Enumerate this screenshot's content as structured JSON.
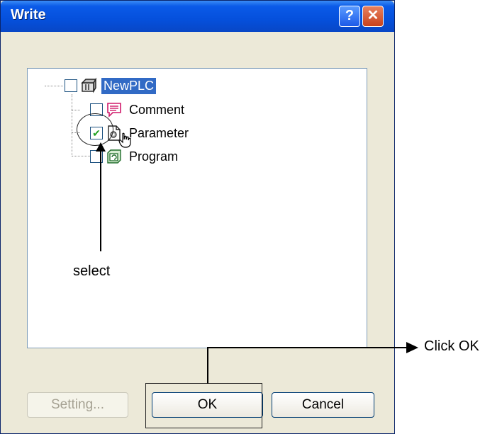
{
  "window": {
    "title": "Write",
    "help_glyph": "?",
    "close_glyph": "✕"
  },
  "tree": {
    "root": {
      "label": "NewPLC",
      "checked": false,
      "icon": "plc-icon"
    },
    "children": [
      {
        "label": "Comment",
        "checked": false,
        "icon": "comment-icon"
      },
      {
        "label": "Parameter",
        "checked": true,
        "icon": "parameter-icon"
      },
      {
        "label": "Program",
        "checked": false,
        "icon": "program-icon"
      }
    ]
  },
  "annotations": {
    "select_label": "select",
    "click_ok_label": "Click OK"
  },
  "buttons": {
    "setting": "Setting...",
    "ok": "OK",
    "cancel": "Cancel"
  },
  "colors": {
    "titlebar": "#0550dc",
    "selection": "#316ac5",
    "dialog_bg": "#ece9d8"
  }
}
